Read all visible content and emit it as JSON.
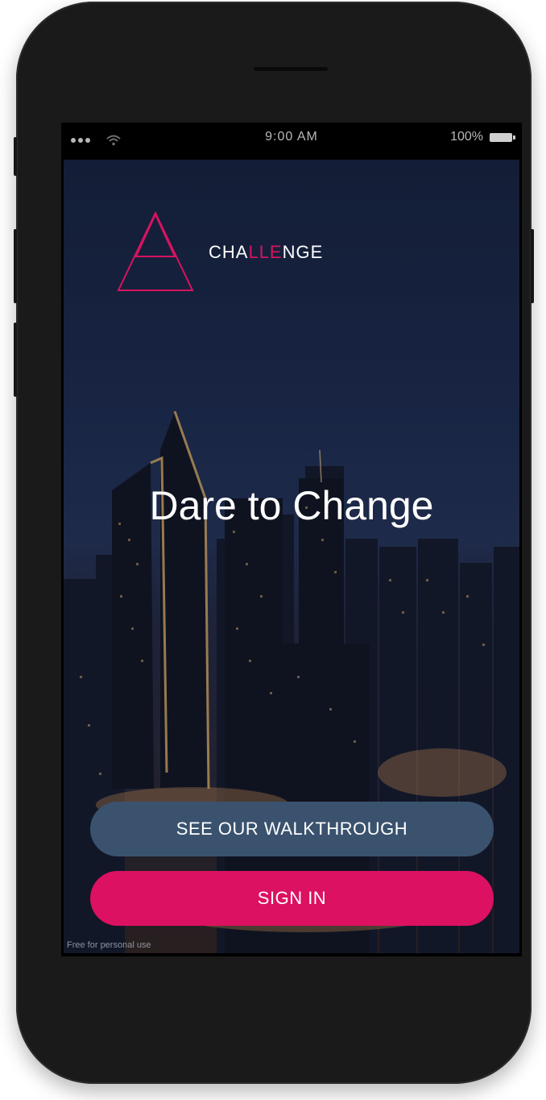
{
  "status_bar": {
    "time": "9:00 AM",
    "battery_text": "100%",
    "signal_icon": "signal-dots-icon",
    "wifi_icon": "wifi-icon",
    "battery_icon": "battery-icon"
  },
  "brand": {
    "name_prefix": "CHA",
    "name_accent": "LLE",
    "name_suffix": "NGE",
    "logo_icon": "triangle-logo-icon",
    "accent_color": "#d8135f"
  },
  "hero": {
    "headline": "Dare to Change"
  },
  "actions": {
    "walkthrough_label": "SEE OUR WALKTHROUGH",
    "walkthrough_color": "#3a526e",
    "signin_label": "SIGN IN",
    "signin_color": "#dc1161"
  },
  "watermark": "Free for personal use"
}
